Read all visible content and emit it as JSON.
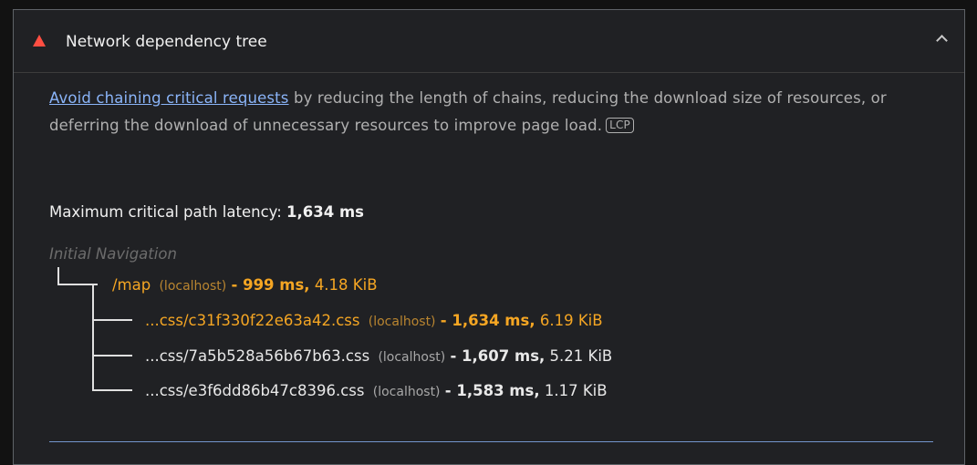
{
  "panel": {
    "title": "Network dependency tree",
    "description_link": "Avoid chaining critical requests",
    "description_rest": " by reducing the length of chains, reducing the download size of resources, or deferring the download of unnecessary resources to improve page load.",
    "badge": "LCP",
    "latency_label": "Maximum critical path latency: ",
    "latency_value": "1,634 ms",
    "initial_navigation": "Initial Navigation"
  },
  "tree": [
    {
      "url": "/map",
      "host": "(localhost)",
      "duration": "- 999 ms,",
      "size": "4.18 KiB"
    },
    {
      "url": "...css/c31f330f22e63a42.css",
      "host": "(localhost)",
      "duration": "- 1,634 ms,",
      "size": "6.19 KiB"
    },
    {
      "url": "...css/7a5b528a56b67b63.css",
      "host": "(localhost)",
      "duration": "- 1,607 ms,",
      "size": "5.21 KiB"
    },
    {
      "url": "...css/e3f6dd86b47c8396.css",
      "host": "(localhost)",
      "duration": "- 1,583 ms,",
      "size": "1.17 KiB"
    }
  ],
  "colors": {
    "warning": "#ff4e42",
    "critical": "#f5a623",
    "link": "#8ab4f8"
  },
  "icons": [
    "warning-triangle-icon",
    "chevron-up-icon"
  ]
}
